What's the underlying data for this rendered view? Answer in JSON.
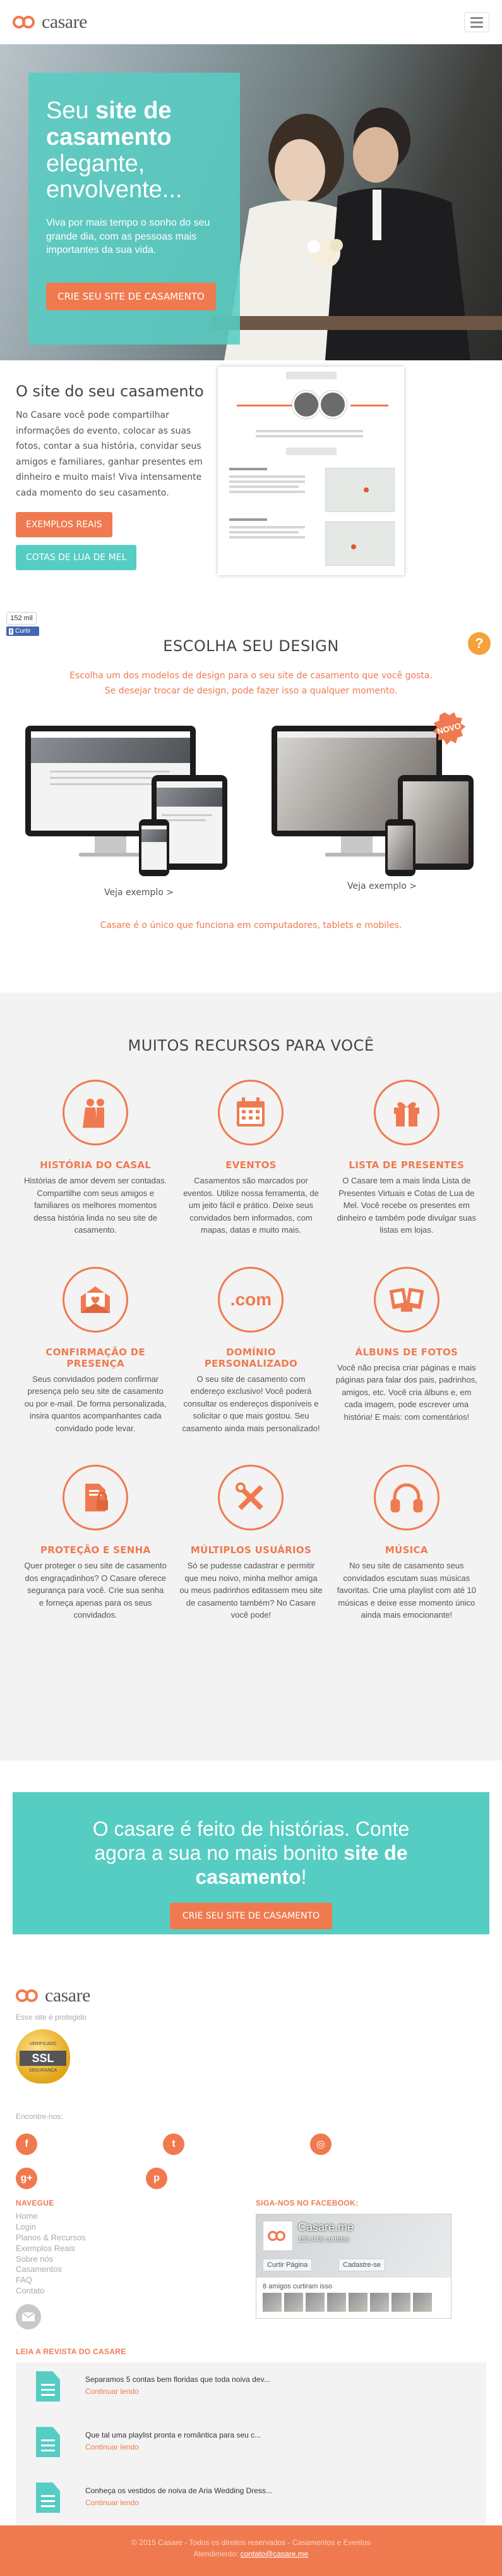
{
  "header": {
    "logo_text": "casare"
  },
  "hero": {
    "title_prefix": "Seu ",
    "title_bold": "site de casamento",
    "title_suffix": " elegante, envolvente...",
    "subtitle": "Viva por mais tempo o sonho do seu grande dia, com as pessoas mais importantes da sua vida.",
    "cta": "CRIE SEU SITE DE CASAMENTO"
  },
  "site_section": {
    "title": "O site do seu casamento",
    "text": "No Casare você pode compartilhar informações do evento, colocar as suas fotos, contar a sua história, convidar seus amigos e familiares, ganhar presentes em dinheiro e muito mais! Viva intensamente cada momento do seu casamento.",
    "btn_examples": "EXEMPLOS REAIS",
    "btn_quotas": "COTAS DE LUA DE MEL"
  },
  "social_counter": {
    "count": "152 mil",
    "fb_label": "Curtir"
  },
  "design": {
    "title": "ESCOLHA SEU DESIGN",
    "subtitle_line1": "Escolha um dos modelos de design para o seu site de casamento que você gosta.",
    "subtitle_line2": "Se desejar trocar de design, pode fazer isso a qualquer momento.",
    "badge": "NOVO",
    "example_link_1": "Veja exemplo >",
    "example_link_2": "Veja exemplo >",
    "note": "Casare é o único que funciona em computadores, tablets e mobiles."
  },
  "features": {
    "title": "MUITOS RECURSOS PARA VOCÊ",
    "items": [
      {
        "icon": "couple-icon",
        "title": "HISTÓRIA DO CASAL",
        "desc": "Histórias de amor devem ser contadas. Compartilhe com seus amigos e familiares os melhores momentos dessa história linda no seu site de casamento."
      },
      {
        "icon": "calendar-icon",
        "title": "EVENTOS",
        "desc": "Casamentos são marcados por eventos. Utilize nossa ferramenta, de um jeito fácil e prático. Deixe seus convidados bem informados, com mapas, datas e muito mais."
      },
      {
        "icon": "gift-icon",
        "title": "LISTA DE PRESENTES",
        "desc": "O Casare tem a mais linda Lista de Presentes Virtuais e Cotas de Lua de Mel. Você recebe os presentes em dinheiro e também pode divulgar suas listas em lojas."
      },
      {
        "icon": "envelope-heart-icon",
        "title": "CONFIRMAÇÃO DE PRESENÇA",
        "desc": "Seus convidados podem confirmar presença pelo seu site de casamento ou por e-mail. De forma personalizada, insira quantos acompanhantes cada convidado pode levar."
      },
      {
        "icon": "dotcom-icon",
        "title": "DOMÍNIO PERSONALIZADO",
        "desc": "O seu site de casamento com endereço exclusivo! Você poderá consultar os endereços disponíveis e solicitar o que mais gostou. Seu casamento ainda mais personalizado!"
      },
      {
        "icon": "photo-album-icon",
        "title": "ÁLBUNS DE FOTOS",
        "desc": "Você não precisa criar páginas e mais páginas para falar dos pais, padrinhos, amigos, etc. Você cria álbuns e, em cada imagem, pode escrever uma história! E mais: com comentários!"
      },
      {
        "icon": "lock-document-icon",
        "title": "PROTEÇÃO E SENHA",
        "desc": "Quer proteger o seu site de casamento dos engraçadinhos? O Casare oferece segurança para você. Crie sua senha e forneça apenas para os seus convidados."
      },
      {
        "icon": "tools-icon",
        "title": "MÚLTIPLOS USUÁRIOS",
        "desc": "Só se pudesse cadastrar e permitir que meu noivo, minha melhor amiga ou meus padrinhos editassem meu site de casamento também? No Casare você pode!"
      },
      {
        "icon": "headphones-icon",
        "title": "MÚSICA",
        "desc": "No seu site de casamento seus convidados escutam suas músicas favoritas. Crie uma playlist com até 10 músicas e deixe esse momento único ainda mais emocionante!"
      }
    ]
  },
  "cta": {
    "title_prefix": "O casare é feito de histórias. Conte agora a sua no mais bonito ",
    "title_bold": "site de casamento",
    "title_suffix": "!",
    "button": "CRIE SEU SITE DE CASAMENTO"
  },
  "footer": {
    "logo_text": "casare",
    "protected": "Esse site é protegido",
    "ssl_top": "VERIFICADO",
    "ssl_label": "SSL",
    "ssl_bottom": "SEGURANÇA",
    "follow": "Encontre-nos:",
    "nav_heading": "NAVEGUE",
    "nav_items": [
      "Home",
      "Login",
      "Planos & Recursos",
      "Exemplos Reais",
      "Sobre nós",
      "Casamentos",
      "FAQ",
      "Contato"
    ],
    "fb_heading": "SIGA-NOS NO FACEBOOK:",
    "fb_page_name": "Casare.me",
    "fb_likes": "152.048 curtidas",
    "fb_like_btn": "Curtir Página",
    "fb_share_btn": "Cadastre-se",
    "fb_friends": "8 amigos curtiram isso",
    "revista_heading": "LEIA A REVISTA DO CASARE",
    "articles": [
      {
        "title": "Separamos 5 contas bem floridas que toda noiva dev...",
        "link": "Continuar lendo"
      },
      {
        "title": "Que tal uma playlist pronta e romântica para seu c...",
        "link": "Continuar lendo"
      },
      {
        "title": "Conheça os vestidos de noiva de Aria Wedding Dress...",
        "link": "Continuar lendo"
      }
    ],
    "copyright": "© 2015 Casare - Todos os direitos reservados - Casamentos e Eventos",
    "contact_prefix": "Atendimento: ",
    "contact_email": "contato@casare.me"
  },
  "colors": {
    "accent_orange": "#f07a4f",
    "accent_teal": "#56cdc3"
  }
}
